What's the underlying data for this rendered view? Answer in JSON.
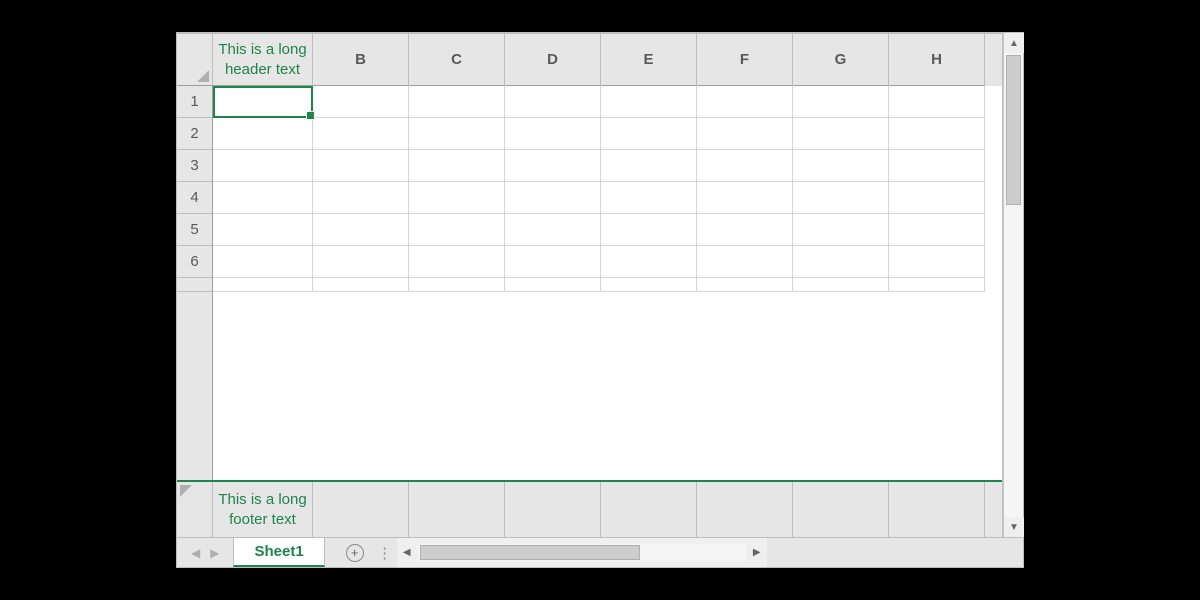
{
  "spreadsheet": {
    "columns": [
      {
        "id": "A",
        "label": "This is a long header text",
        "footer": "This is a long footer text"
      },
      {
        "id": "B",
        "label": "B",
        "footer": ""
      },
      {
        "id": "C",
        "label": "C",
        "footer": ""
      },
      {
        "id": "D",
        "label": "D",
        "footer": ""
      },
      {
        "id": "E",
        "label": "E",
        "footer": ""
      },
      {
        "id": "F",
        "label": "F",
        "footer": ""
      },
      {
        "id": "G",
        "label": "G",
        "footer": ""
      },
      {
        "id": "H",
        "label": "H",
        "footer": ""
      }
    ],
    "rows": [
      "1",
      "2",
      "3",
      "4",
      "5",
      "6"
    ],
    "active_cell": "A1",
    "active_sheet": "Sheet1"
  },
  "tabs": {
    "sheet1": "Sheet1"
  }
}
